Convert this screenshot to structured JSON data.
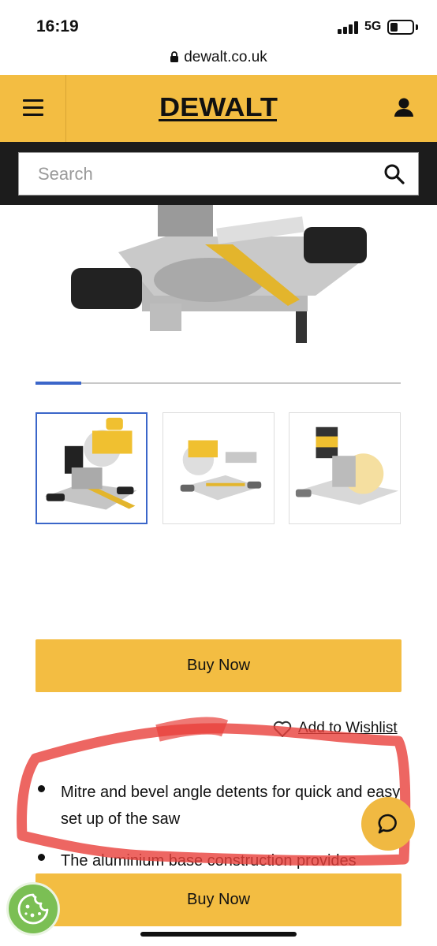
{
  "status_bar": {
    "time": "16:19",
    "network": "5G"
  },
  "browser": {
    "url": "dewalt.co.uk"
  },
  "header": {
    "logo_text": "DEWALT",
    "search_placeholder": "Search"
  },
  "gallery": {
    "progress_fraction": 0.125,
    "thumbnail_count": 3,
    "active_index": 0
  },
  "product": {
    "buy_now_label": "Buy Now",
    "wishlist_label": "Add to Wishlist",
    "features": [
      "Mitre and bevel angle detents for quick and easy set up of the saw",
      "The aluminium base construction provides"
    ]
  },
  "colors": {
    "brand_yellow": "#f3bd42",
    "header_dark": "#1c1c1c",
    "accent_blue": "#3b66c9",
    "annotation_red": "#e8403b",
    "cookie_green": "#7bbf54"
  },
  "icons": [
    "lock-icon",
    "hamburger-menu-icon",
    "account-icon",
    "search-icon",
    "heart-icon",
    "chat-icon",
    "cookie-icon"
  ]
}
